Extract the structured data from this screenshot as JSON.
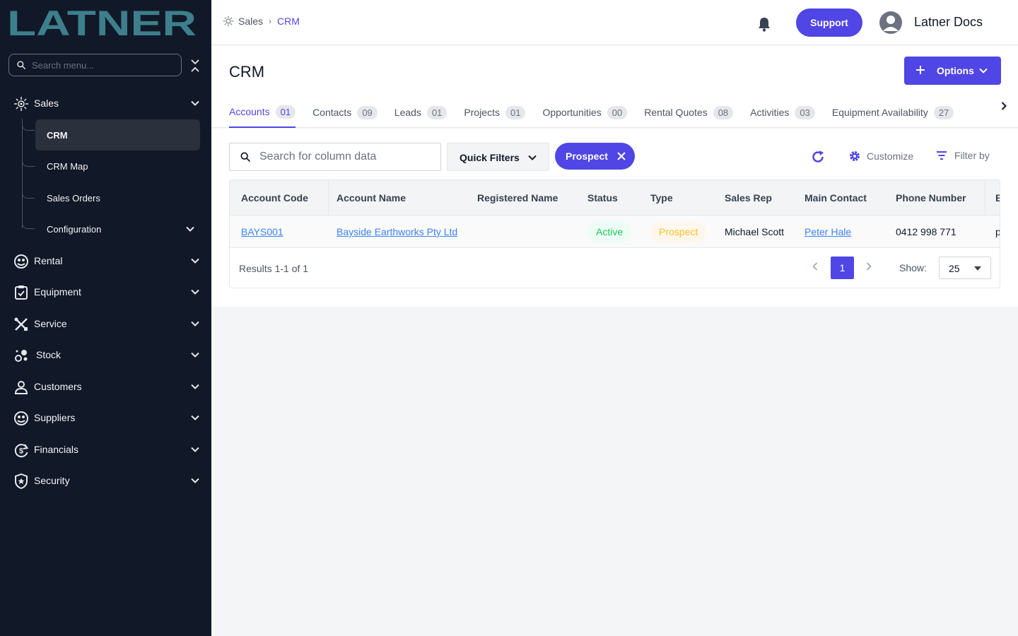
{
  "brand": {
    "logo_text": "LATNER",
    "logo_color": "#3d7f8c"
  },
  "sidebar": {
    "search_placeholder": "Search menu...",
    "items": [
      {
        "label": "Sales",
        "icon": "sales-icon",
        "expanded": true
      },
      {
        "label": "Rental",
        "icon": "rental-icon"
      },
      {
        "label": "Equipment",
        "icon": "clipboard-check-icon"
      },
      {
        "label": "Service",
        "icon": "tools-icon"
      },
      {
        "label": "Stock",
        "icon": "stock-icon"
      },
      {
        "label": "Customers",
        "icon": "person-icon"
      },
      {
        "label": "Suppliers",
        "icon": "suppliers-icon"
      },
      {
        "label": "Financials",
        "icon": "dollar-cycle-icon"
      },
      {
        "label": "Security",
        "icon": "shield-star-icon"
      }
    ],
    "sales_children": [
      {
        "label": "CRM",
        "active": true
      },
      {
        "label": "CRM Map"
      },
      {
        "label": "Sales Orders"
      },
      {
        "label": "Configuration",
        "has_children": true
      }
    ]
  },
  "topbar": {
    "breadcrumb": [
      "Sales",
      "CRM"
    ],
    "support_label": "Support",
    "user_name": "Latner Docs"
  },
  "page": {
    "title": "CRM",
    "options_label": "Options",
    "tabs": [
      {
        "label": "Accounts",
        "count": "01",
        "active": true
      },
      {
        "label": "Contacts",
        "count": "09"
      },
      {
        "label": "Leads",
        "count": "01"
      },
      {
        "label": "Projects",
        "count": "01"
      },
      {
        "label": "Opportunities",
        "count": "00"
      },
      {
        "label": "Rental Quotes",
        "count": "08"
      },
      {
        "label": "Activities",
        "count": "03"
      },
      {
        "label": "Equipment Availability",
        "count": "27"
      }
    ]
  },
  "toolbar": {
    "search_placeholder": "Search for column data",
    "quick_filters_label": "Quick Filters",
    "active_filter_chip": "Prospect",
    "customize_label": "Customize",
    "filter_by_label": "Filter by"
  },
  "table": {
    "columns": [
      "Account Code",
      "Account Name",
      "Registered Name",
      "Status",
      "Type",
      "Sales Rep",
      "Main Contact",
      "Phone Number",
      "E"
    ],
    "rows": [
      {
        "account_code": "BAYS001",
        "account_name": "Bayside Earthworks Pty Ltd",
        "registered_name": "",
        "status": "Active",
        "type": "Prospect",
        "sales_rep": "Michael Scott",
        "main_contact": "Peter Hale",
        "phone": "0412 998 771",
        "email_partial": "p"
      }
    ],
    "results_text": "Results 1-1 of 1",
    "current_page": "1",
    "show_label": "Show:",
    "page_size": "25"
  },
  "colors": {
    "accent": "#4f46e5",
    "sidebar_bg": "#111827",
    "status_active": "#22c55e",
    "type_prospect": "#fbbf24",
    "link": "#3b82f6"
  }
}
